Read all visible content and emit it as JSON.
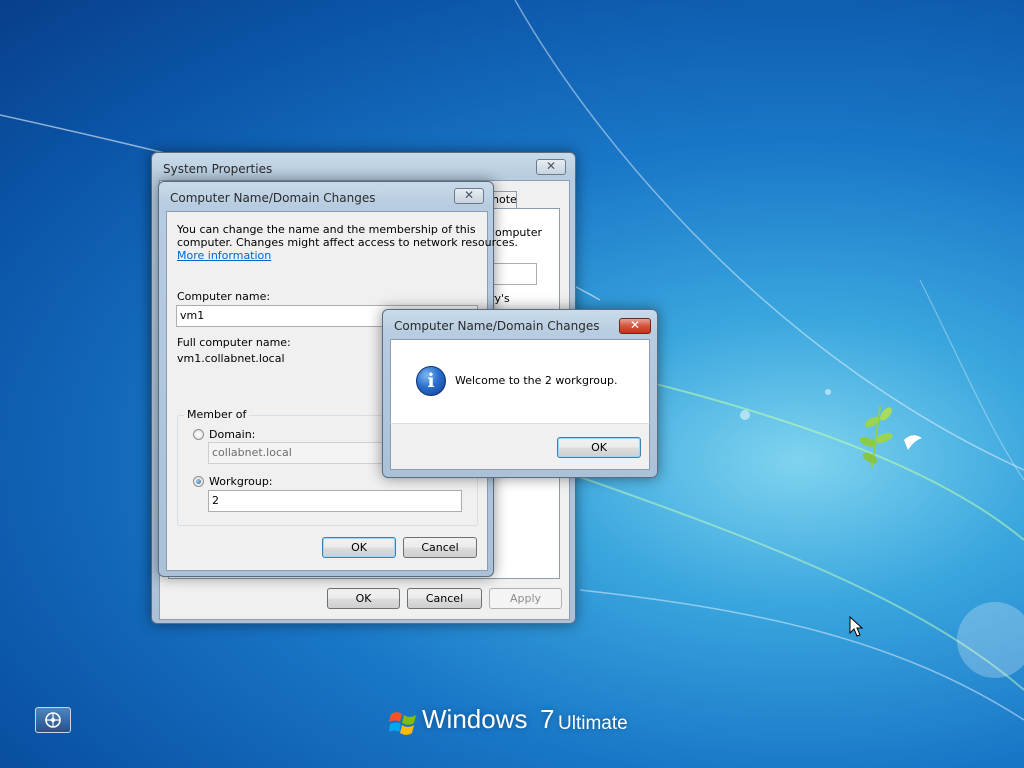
{
  "desktop": {
    "logo_windows": "Windows",
    "logo_version": "7",
    "logo_edition": "Ultimate"
  },
  "system_properties": {
    "title": "System Properties",
    "tab_partial": "note",
    "partial_text_1": "omputer",
    "partial_text_2": "ry's",
    "ok_label": "OK",
    "cancel_label": "Cancel",
    "apply_label": "Apply"
  },
  "domain_changes": {
    "title": "Computer Name/Domain Changes",
    "description_line1": "You can change the name and the membership of this",
    "description_line2": "computer. Changes might affect access to network resources.",
    "more_info_link": "More information",
    "computer_name_label": "Computer name:",
    "computer_name_value": "vm1",
    "full_name_label": "Full computer name:",
    "full_name_value": "vm1.collabnet.local",
    "member_of_label": "Member of",
    "domain_label": "Domain:",
    "domain_value": "collabnet.local",
    "workgroup_label": "Workgroup:",
    "workgroup_value": "2",
    "ok_label": "OK",
    "cancel_label": "Cancel"
  },
  "welcome_dialog": {
    "title": "Computer Name/Domain Changes",
    "message": "Welcome to the 2 workgroup.",
    "ok_label": "OK"
  },
  "colors": {
    "desktop_blue": "#1a78c8",
    "window_frame": "#b7cce0",
    "close_red": "#c5321a"
  }
}
